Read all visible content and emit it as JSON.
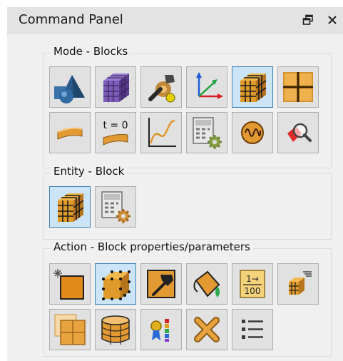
{
  "panel": {
    "title": "Command Panel",
    "float_icon": "float-window-icon",
    "close_icon": "close-icon"
  },
  "mode_group": {
    "title": "Mode - Blocks",
    "row1": [
      "geometry-icon",
      "mesh-icon",
      "tools-icon",
      "coordinate-axes-icon",
      "blocks-icon",
      "grid-partition-icon"
    ],
    "row2": [
      "sheet-icon",
      "initial-condition-icon",
      "curve-plot-icon",
      "calculator-settings-icon",
      "waveform-icon",
      "inspect-icon"
    ],
    "t0_label": "t = 0",
    "active": "blocks-icon"
  },
  "entity_group": {
    "title": "Entity - Block",
    "items": [
      "block-entity-icon",
      "block-settings-icon"
    ],
    "active": "block-entity-icon"
  },
  "action_group": {
    "title": "Action - Block properties/parameters",
    "row1": [
      "create-block-icon",
      "block-vertices-icon",
      "assign-tool-icon",
      "paint-bucket-icon",
      "renumber-icon",
      "block-list-icon"
    ],
    "row2": [
      "split-block-icon",
      "cylinder-block-icon",
      "color-legend-icon",
      "delete-icon",
      "list-icon"
    ],
    "renumber_top": "1→",
    "renumber_bottom": "100",
    "active": "block-vertices-icon"
  }
}
